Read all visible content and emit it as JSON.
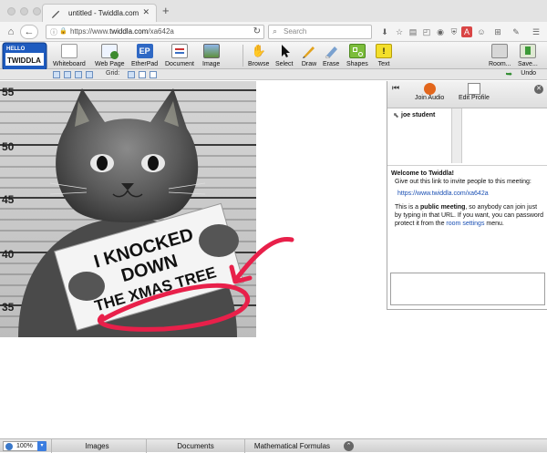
{
  "browser": {
    "tab_title": "untitled - Twiddla.com",
    "url_prefix": "https://www.",
    "url_domain": "twiddla.com",
    "url_path": "/xa642a",
    "search_placeholder": "Search",
    "new_tab_label": "+"
  },
  "toolbar": {
    "logo_hello": "HELLO",
    "logo_name": "TWIDDLA",
    "tools": [
      {
        "label": "Whiteboard",
        "icon": "whiteboard-icon"
      },
      {
        "label": "Web Page",
        "icon": "web-page-icon"
      },
      {
        "label": "EtherPad",
        "icon": "etherpad-icon"
      },
      {
        "label": "Document",
        "icon": "document-icon"
      },
      {
        "label": "Image",
        "icon": "image-icon"
      },
      {
        "label": "Browse",
        "icon": "hand-icon"
      },
      {
        "label": "Select",
        "icon": "arrow-icon"
      },
      {
        "label": "Draw",
        "icon": "pencil-icon"
      },
      {
        "label": "Erase",
        "icon": "eraser-icon"
      },
      {
        "label": "Shapes",
        "icon": "shapes-icon"
      },
      {
        "label": "Text",
        "icon": "text-icon"
      },
      {
        "label": "Room...",
        "icon": "room-icon"
      },
      {
        "label": "Save...",
        "icon": "save-icon"
      }
    ],
    "etherpad_badge": "EP",
    "grid_label": "Grid:",
    "undo_label": "Undo"
  },
  "canvas": {
    "photo_markers": [
      "55",
      "50",
      "45",
      "40",
      "35"
    ],
    "sign_lines": [
      "I KNOCKED",
      "DOWN",
      "THE XMAS TREE"
    ],
    "colors": {
      "ink": "#e8204a"
    }
  },
  "panel": {
    "join_audio": "Join Audio",
    "edit_profile": "Edit Profile",
    "user": "joe student",
    "welcome_title": "Welcome to Twiddla!",
    "welcome_invite": "Give out this link to invite people to this meeting:",
    "meeting_link": "https://www.twiddla.com/xa642a",
    "public_text_1": "This is a ",
    "public_bold": "public meeting",
    "public_text_2": ", so anybody can join just by typing in that URL. If you want, you can password protect it from the ",
    "room_settings": "room settings",
    "public_text_3": " menu."
  },
  "bottom": {
    "zoom": "100%",
    "tabs": [
      "Images",
      "Documents",
      "Mathematical Formulas"
    ]
  }
}
